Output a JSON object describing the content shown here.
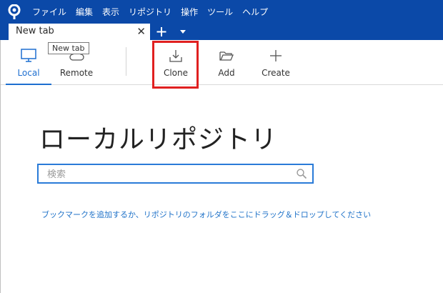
{
  "menu": {
    "items": [
      "ファイル",
      "編集",
      "表示",
      "リポジトリ",
      "操作",
      "ツール",
      "ヘルプ"
    ]
  },
  "tab": {
    "title": "New tab",
    "close_glyph": "✕",
    "tooltip": "New tab"
  },
  "toolbar": {
    "local_label": "Local",
    "remote_label": "Remote",
    "clone_label": "Clone",
    "add_label": "Add",
    "create_label": "Create"
  },
  "main": {
    "title": "ローカルリポジトリ",
    "search_placeholder": "検索",
    "hint": "ブックマークを追加するか、リポジトリのフォルダをここにドラッグ＆ドロップしてください"
  },
  "colors": {
    "menubar_bg": "#0b49a8",
    "accent": "#1e6fd0",
    "highlight": "#e02020"
  }
}
